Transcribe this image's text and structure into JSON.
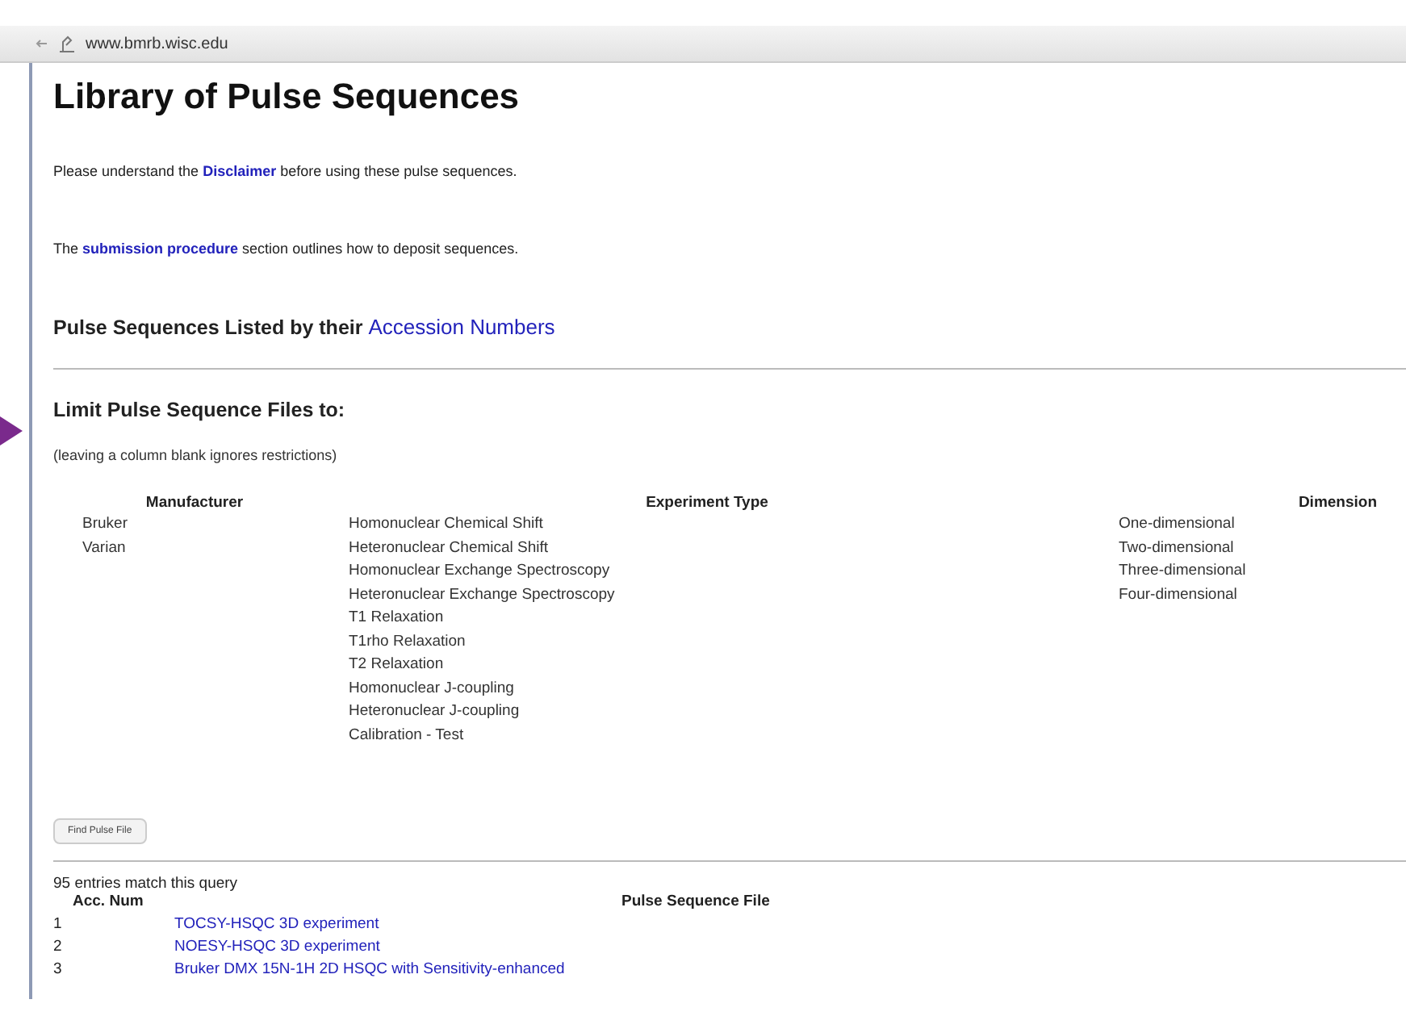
{
  "browser": {
    "url": "www.bmrb.wisc.edu"
  },
  "page": {
    "title": "Library of Pulse Sequences",
    "notes": [
      {
        "before": "Please understand the ",
        "link": "Disclaimer",
        "after": " before using these pulse sequences."
      },
      {
        "before": "The ",
        "link": "submission procedure",
        "after": " section outlines how to deposit sequences."
      }
    ],
    "listed_heading": {
      "text": "Pulse Sequences Listed by their ",
      "link": "Accession Numbers"
    },
    "limit_heading": "Limit Pulse Sequence Files to:",
    "limit_hint": "(leaving a column blank ignores restrictions)",
    "filters": [
      {
        "header": "Manufacturer",
        "options": [
          "Bruker",
          "Varian"
        ]
      },
      {
        "header": "Experiment Type",
        "options": [
          "Homonuclear Chemical Shift",
          "Heteronuclear Chemical Shift",
          "Homonuclear Exchange Spectroscopy",
          "Heteronuclear Exchange Spectroscopy",
          "T1 Relaxation",
          "T1rho Relaxation",
          "T2 Relaxation",
          "Homonuclear J-coupling",
          "Heteronuclear J-coupling",
          "Calibration - Test"
        ]
      },
      {
        "header": "Dimension",
        "options": [
          "One-dimensional",
          "Two-dimensional",
          "Three-dimensional",
          "Four-dimensional"
        ]
      }
    ],
    "find_button": "Find Pulse File",
    "results": {
      "count": "95 entries match this query",
      "columns": [
        "Acc. Num",
        "Pulse Sequence File"
      ],
      "rows": [
        {
          "num": "1",
          "file": "TOCSY-HSQC 3D experiment"
        },
        {
          "num": "2",
          "file": "NOESY-HSQC 3D experiment"
        },
        {
          "num": "3",
          "file": "Bruker DMX 15N-1H 2D HSQC with Sensitivity-enhanced"
        }
      ]
    }
  }
}
